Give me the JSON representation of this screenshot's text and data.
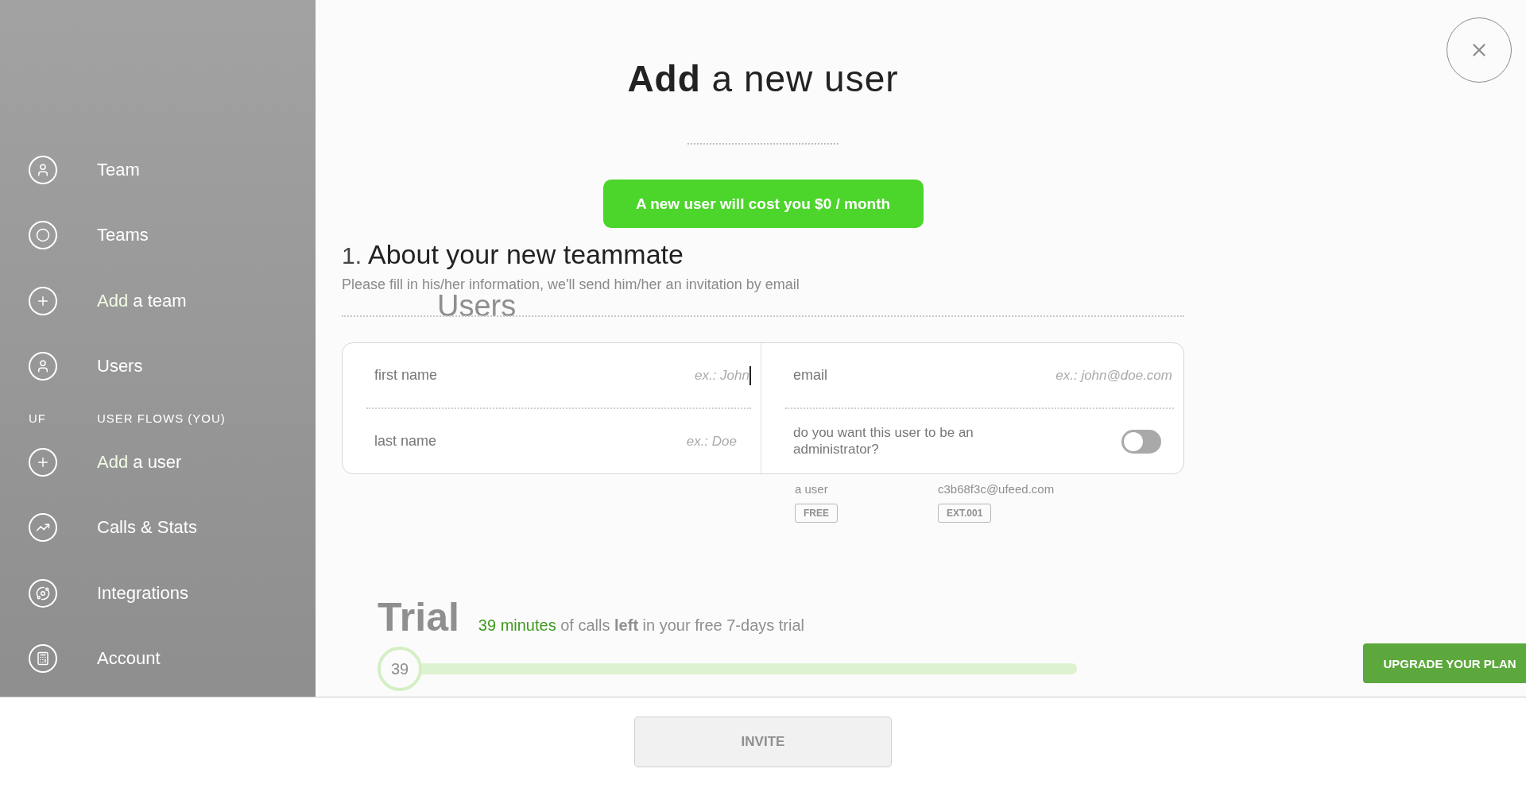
{
  "background": {
    "sidebar": {
      "items": [
        {
          "kind": "user",
          "label": "Team"
        },
        {
          "kind": "circle",
          "label": "Teams"
        },
        {
          "kind": "plus",
          "accent": "Add",
          "label": "a team"
        },
        {
          "kind": "user",
          "label": "Users"
        },
        {
          "kind": "flow",
          "accent": "UF",
          "label": "USER FLOWS (YOU)"
        },
        {
          "kind": "plus",
          "accent": "Add",
          "label": "a user"
        },
        {
          "kind": "stats",
          "label": "Calls & Stats"
        },
        {
          "kind": "integrations",
          "label": "Integrations"
        },
        {
          "kind": "account",
          "label": "Account"
        }
      ]
    },
    "users_heading": "Users",
    "user_card": {
      "name": "a user",
      "email": "c3b68f3c@ufeed.com",
      "tags": [
        "FREE",
        "EXT.001"
      ]
    },
    "trial": {
      "title": "Trial",
      "highlight": "39 minutes",
      "text": "of calls **left** in your free 7-days trial",
      "badge": "39",
      "upgrade_button": "UPGRADE YOUR PLAN"
    }
  },
  "modal": {
    "title_bold": "Add",
    "title": "a new user",
    "cost_button": "A new user will cost you $0 / month",
    "step_number": "1.",
    "step_title": "About your new teammate",
    "step_subtitle": "Please fill in his/her information, we'll send him/her an invitation by email",
    "fields": [
      {
        "label": "first name",
        "placeholder": "ex.: John",
        "focused": true
      },
      {
        "label": "last name",
        "placeholder": "ex.: Doe",
        "focused": false
      },
      {
        "label": "email",
        "placeholder": "ex.: john@doe.com",
        "focused": false
      }
    ],
    "admin": {
      "label": "do you want this user to be an administrator?",
      "on": false
    }
  },
  "footer": {
    "invite_button": {
      "label": "INVITE",
      "disabled": true
    }
  }
}
